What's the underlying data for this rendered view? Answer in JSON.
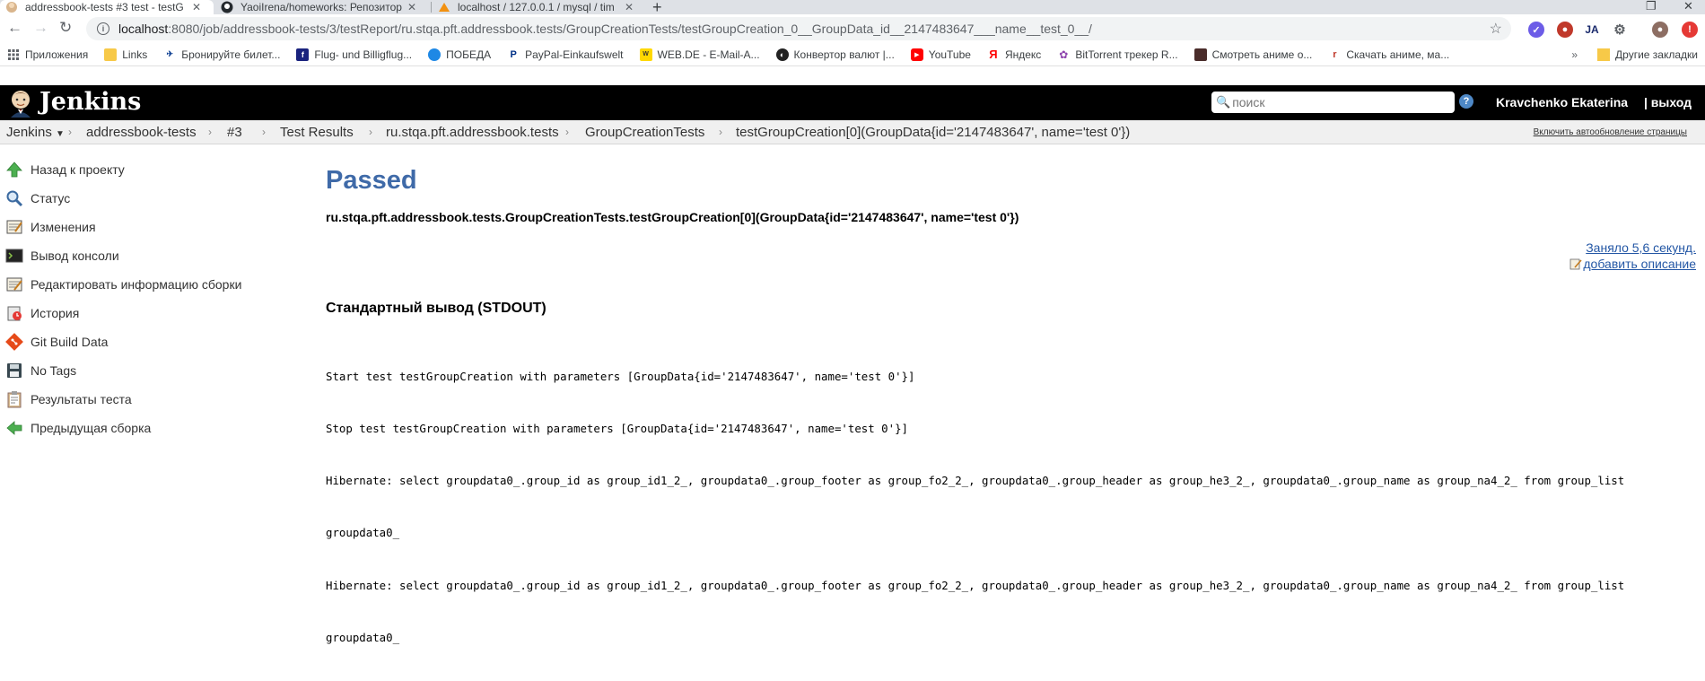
{
  "browser": {
    "tabs": [
      {
        "title": "addressbook-tests #3 test - testG",
        "favicon": "jenkins-icon"
      },
      {
        "title": "YaoiIrena/homeworks: Репозиторий",
        "favicon": "github-icon"
      },
      {
        "title": "localhost / 127.0.0.1 / mysql / tim",
        "favicon": "phpmyadmin-icon"
      }
    ],
    "url_host": "localhost",
    "url_path": ":8080/job/addressbook-tests/3/testReport/ru.stqa.pft.addressbook.tests/GroupCreationTests/testGroupCreation_0__GroupData_id__2147483647___name__test_0__/",
    "bookmarks": [
      {
        "label": "Приложения",
        "icon": "apps-grid-icon"
      },
      {
        "label": "Links",
        "icon": "folder-icon"
      },
      {
        "label": "Бронируйте билет...",
        "icon": "airline-icon"
      },
      {
        "label": "Flug- und Billigflug...",
        "icon": "flight-icon"
      },
      {
        "label": "ПОБЕДА",
        "icon": "pobeda-icon"
      },
      {
        "label": "PayPal-Einkaufswelt",
        "icon": "paypal-icon"
      },
      {
        "label": "WEB.DE - E-Mail-A...",
        "icon": "webde-icon"
      },
      {
        "label": "Конвертор валют |...",
        "icon": "currency-icon"
      },
      {
        "label": "YouTube",
        "icon": "youtube-icon"
      },
      {
        "label": "Яндекс",
        "icon": "yandex-icon"
      },
      {
        "label": "BitTorrent трекер R...",
        "icon": "torrent-icon"
      },
      {
        "label": "Смотреть аниме о...",
        "icon": "anime-icon"
      },
      {
        "label": "Скачать аниме, ма...",
        "icon": "download-icon"
      }
    ],
    "other_bookmarks": "Другие закладки"
  },
  "jenkins": {
    "title": "Jenkins",
    "search_placeholder": "поиск",
    "user": "Kravchenko Ekaterina",
    "logout": "| выход"
  },
  "breadcrumbs": [
    "Jenkins",
    "addressbook-tests",
    "#3",
    "Test Results",
    "ru.stqa.pft.addressbook.tests",
    "GroupCreationTests",
    "testGroupCreation[0](GroupData{id='2147483647', name='test 0'})"
  ],
  "autorefresh": "Включить автообновление страницы",
  "sidebar": {
    "items": [
      {
        "label": "Назад к проекту",
        "icon": "up-arrow-icon"
      },
      {
        "label": "Статус",
        "icon": "magnifier-icon"
      },
      {
        "label": "Изменения",
        "icon": "notepad-icon"
      },
      {
        "label": "Вывод консоли",
        "icon": "terminal-icon"
      },
      {
        "label": "Редактировать информацию сборки",
        "icon": "edit-notepad-icon"
      },
      {
        "label": "История",
        "icon": "history-icon"
      },
      {
        "label": "Git Build Data",
        "icon": "git-icon"
      },
      {
        "label": "No Tags",
        "icon": "save-icon"
      },
      {
        "label": "Результаты теста",
        "icon": "clipboard-icon"
      },
      {
        "label": "Предыдущая сборка",
        "icon": "left-arrow-icon"
      }
    ]
  },
  "main": {
    "status": "Passed",
    "test_name": "ru.stqa.pft.addressbook.tests.GroupCreationTests.testGroupCreation[0](GroupData{id='2147483647', name='test 0'})",
    "duration": "Заняло 5,6 секунд.",
    "add_description": "добавить описание",
    "stdout_title": "Стандартный вывод (STDOUT)",
    "stdout_lines": [
      "Start test testGroupCreation with parameters [GroupData{id='2147483647', name='test 0'}]",
      "Stop test testGroupCreation with parameters [GroupData{id='2147483647', name='test 0'}]",
      "Hibernate: select groupdata0_.group_id as group_id1_2_, groupdata0_.group_footer as group_fo2_2_, groupdata0_.group_header as group_he3_2_, groupdata0_.group_name as group_na4_2_ from group_list",
      "groupdata0_",
      "Hibernate: select groupdata0_.group_id as group_id1_2_, groupdata0_.group_footer as group_fo2_2_, groupdata0_.group_header as group_he3_2_, groupdata0_.group_name as group_na4_2_ from group_list",
      "groupdata0_"
    ]
  }
}
